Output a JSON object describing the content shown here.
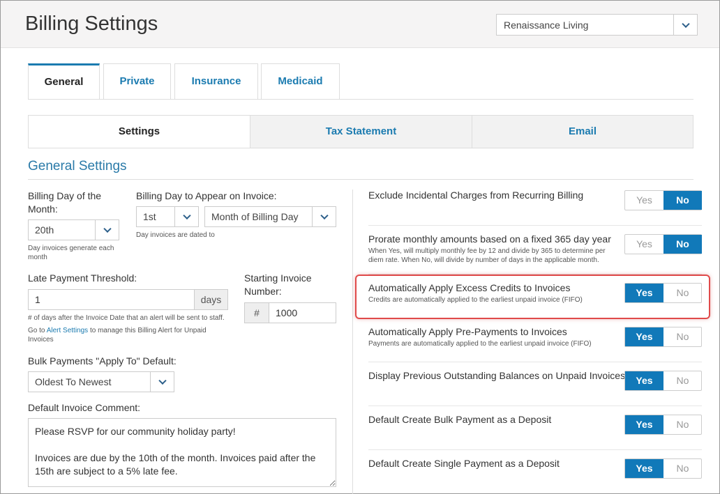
{
  "header": {
    "title": "Billing Settings",
    "facility": "Renaissance Living"
  },
  "tabs": [
    "General",
    "Private",
    "Insurance",
    "Medicaid"
  ],
  "subtabs": [
    "Settings",
    "Tax Statement",
    "Email"
  ],
  "section_title": "General Settings",
  "left": {
    "billing_day_label": "Billing Day of the Month:",
    "billing_day_value": "20th",
    "billing_day_hint": "Day invoices generate each month",
    "invoice_day_label": "Billing Day to Appear on Invoice:",
    "invoice_day_value": "1st",
    "invoice_month_value": "Month of Billing Day",
    "invoice_day_hint": "Day invoices are dated to",
    "late_label": "Late Payment Threshold:",
    "late_value": "1",
    "late_unit": "days",
    "late_hint": "# of days after the Invoice Date that an alert will be sent to staff.",
    "alert_hint_pre": "Go to ",
    "alert_link": "Alert Settings",
    "alert_hint_post": " to manage this Billing Alert for Unpaid Invoices",
    "start_label": "Starting Invoice Number:",
    "start_prefix": "#",
    "start_value": "1000",
    "bulk_label": "Bulk Payments \"Apply To\" Default:",
    "bulk_value": "Oldest To Newest",
    "comment_label": "Default Invoice Comment:",
    "comment_value": "Please RSVP for our community holiday party!\n\nInvoices are due by the 10th of the month. Invoices paid after the 15th are subject to a 5% late fee."
  },
  "right": {
    "yes_label": "Yes",
    "no_label": "No",
    "rows": [
      {
        "label": "Exclude Incidental Charges from Recurring Billing",
        "hint": "",
        "value": "No"
      },
      {
        "label": "Prorate monthly amounts based on a fixed 365 day year",
        "hint": "When Yes, will multiply monthly fee by 12 and divide by 365 to determine per diem rate. When No, will divide by number of days in the applicable month.",
        "value": "No"
      },
      {
        "label": "Automatically Apply Excess Credits to Invoices",
        "hint": "Credits are automatically applied to the earliest unpaid invoice (FIFO)",
        "value": "Yes"
      },
      {
        "label": "Automatically Apply Pre-Payments to Invoices",
        "hint": "Payments are automatically applied to the earliest unpaid invoice (FIFO)",
        "value": "Yes"
      },
      {
        "label": "Display Previous Outstanding Balances on Unpaid Invoices",
        "hint": "",
        "value": "Yes"
      },
      {
        "label": "Default Create Bulk Payment as a Deposit",
        "hint": "",
        "value": "Yes"
      },
      {
        "label": "Default Create Single Payment as a Deposit",
        "hint": "",
        "value": "Yes"
      }
    ]
  },
  "colors": {
    "accent": "#1179b9",
    "link": "#1b7bb0",
    "highlight": "#e04a4a"
  }
}
